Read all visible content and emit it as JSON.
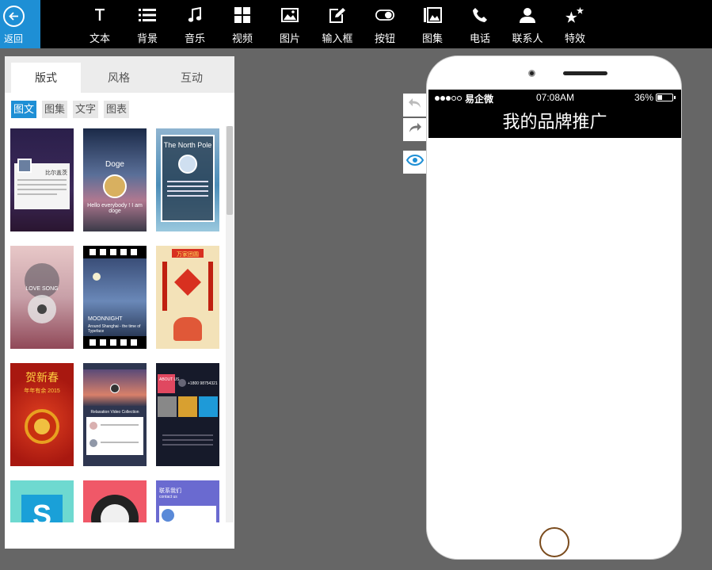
{
  "toolbar": {
    "back_label": "返回",
    "tools": [
      {
        "id": "text",
        "label": "文本",
        "icon": "text-icon"
      },
      {
        "id": "background",
        "label": "背景",
        "icon": "list-icon"
      },
      {
        "id": "music",
        "label": "音乐",
        "icon": "music-note-icon"
      },
      {
        "id": "video",
        "label": "视频",
        "icon": "grid-icon"
      },
      {
        "id": "image",
        "label": "图片",
        "icon": "image-icon"
      },
      {
        "id": "input",
        "label": "输入框",
        "icon": "edit-icon"
      },
      {
        "id": "button",
        "label": "按钮",
        "icon": "toggle-icon"
      },
      {
        "id": "gallery",
        "label": "图集",
        "icon": "gallery-icon"
      },
      {
        "id": "phone",
        "label": "电话",
        "icon": "phone-icon"
      },
      {
        "id": "contact",
        "label": "联系人",
        "icon": "user-icon"
      },
      {
        "id": "effects",
        "label": "特效",
        "icon": "stars-icon"
      }
    ]
  },
  "panel": {
    "tabs": [
      "版式",
      "风格",
      "互动"
    ],
    "active_tab": 0,
    "subtabs": [
      "图文",
      "图集",
      "文字",
      "图表"
    ],
    "active_subtab": 0,
    "thumbnails": [
      {
        "title": "",
        "caption": "比尔盖茨"
      },
      {
        "title": "Doge",
        "caption": "Hello everybody ! I am doge"
      },
      {
        "title": "The North Pole",
        "caption": ""
      },
      {
        "title": "LOVE SONG",
        "caption": ""
      },
      {
        "title": "MOONNIGHT",
        "caption": "Around Shanghai - the time of Typeface"
      },
      {
        "title": "万家团圆",
        "caption": ""
      },
      {
        "title": "贺新春",
        "caption": "年年有余 2015"
      },
      {
        "title": "Relaxation Video Collection",
        "caption": ""
      },
      {
        "title": "ABOUT US",
        "caption": "+1800 98754321"
      },
      {
        "title": "",
        "caption": ""
      },
      {
        "title": "",
        "caption": ""
      },
      {
        "title": "联系我们",
        "caption": "contact us"
      }
    ]
  },
  "phone": {
    "carrier": "易企微",
    "time": "07:08AM",
    "battery": "36%",
    "battery_level": 0.36,
    "title": "我的品牌推广"
  },
  "colors": {
    "accent": "#1e8fd5",
    "toolbar_bg": "#000000",
    "canvas_bg": "#666666"
  }
}
